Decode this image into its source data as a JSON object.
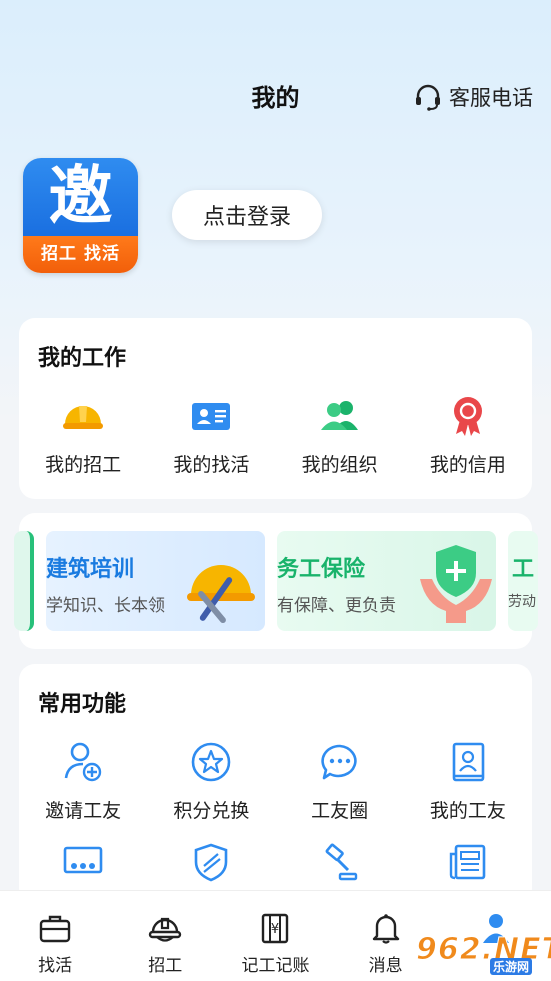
{
  "header": {
    "title": "我的",
    "service_label": "客服电话"
  },
  "logo": {
    "main_char": "邀",
    "tagline": "招工 找活"
  },
  "login": {
    "label": "点击登录"
  },
  "my_work": {
    "title": "我的工作",
    "items": [
      {
        "label": "我的招工",
        "icon": "helmet-icon"
      },
      {
        "label": "我的找活",
        "icon": "id-card-icon"
      },
      {
        "label": "我的组织",
        "icon": "group-icon"
      },
      {
        "label": "我的信用",
        "icon": "medal-icon"
      }
    ]
  },
  "banners": [
    {
      "title": "建筑培训",
      "subtitle": "学知识、长本领",
      "title_color": "#1a7be0"
    },
    {
      "title": "务工保险",
      "subtitle": "有保障、更负责",
      "title_color": "#19b36b"
    },
    {
      "title": "工",
      "subtitle": "劳动",
      "title_color": "#19b36b"
    }
  ],
  "common": {
    "title": "常用功能",
    "items": [
      {
        "label": "邀请工友",
        "icon": "invite-user-icon"
      },
      {
        "label": "积分兑换",
        "icon": "star-badge-icon"
      },
      {
        "label": "工友圈",
        "icon": "chat-bubbles-icon"
      },
      {
        "label": "我的工友",
        "icon": "contacts-book-icon"
      }
    ],
    "row2_icons": [
      "meeting-icon",
      "shield-icon",
      "gavel-icon",
      "newspaper-icon"
    ]
  },
  "tabbar": {
    "items": [
      {
        "label": "找活",
        "icon": "briefcase-icon"
      },
      {
        "label": "招工",
        "icon": "hardhat-icon"
      },
      {
        "label": "记工记账",
        "icon": "ledger-icon"
      },
      {
        "label": "消息",
        "icon": "bell-icon"
      },
      {
        "label": "",
        "icon": "profile-icon"
      }
    ]
  },
  "watermark": {
    "text": "962.NET",
    "sub": "乐游网"
  },
  "colors": {
    "accent_blue": "#2f8cf0",
    "orange": "#f25f0a",
    "green": "#19b36b",
    "red": "#e9474a"
  }
}
